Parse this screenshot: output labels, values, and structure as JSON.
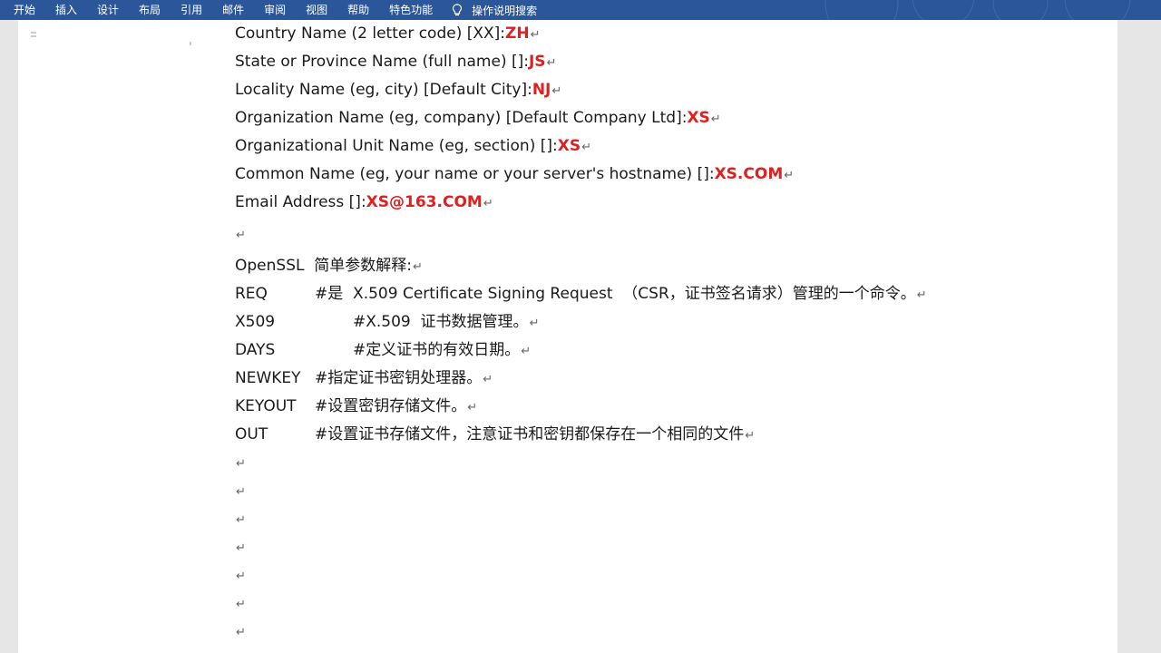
{
  "ribbon": {
    "tabs": [
      "开始",
      "插入",
      "设计",
      "布局",
      "引用",
      "邮件",
      "审阅",
      "视图",
      "帮助",
      "特色功能"
    ],
    "tell_me": "操作说明搜索",
    "tell_me_icon": "lightbulb-icon",
    "accent": "#2b579a"
  },
  "document": {
    "fields": [
      {
        "label": "Country Name (2 letter code) [XX]:",
        "value": "ZH"
      },
      {
        "label": "State or Province Name (full name) []:",
        "value": "JS"
      },
      {
        "label": "Locality Name (eg, city) [Default City]:",
        "value": "NJ"
      },
      {
        "label": "Organization Name (eg, company) [Default Company Ltd]:",
        "value": "XS"
      },
      {
        "label": "Organizational Unit Name (eg, section) []:",
        "value": "XS"
      },
      {
        "label": "Common Name (eg, your name or your server's hostname) []:",
        "value": "XS.COM"
      },
      {
        "label": "Email Address []:",
        "value": "XS@163.COM"
      }
    ],
    "value_color": "#e02020",
    "paragraph_mark": "↵",
    "section_title": "OpenSSL  简单参数解释:",
    "params": [
      {
        "name": "REQ",
        "desc": "#是  X.509 Certificate Signing Request  （CSR，证书签名请求）管理的一个命令。"
      },
      {
        "name": "X509",
        "desc": "#X.509  证书数据管理。"
      },
      {
        "name": "DAYS",
        "desc": "#定义证书的有效日期。"
      },
      {
        "name": "NEWKEY",
        "desc": "#指定证书密钥处理器。"
      },
      {
        "name": "KEYOUT",
        "desc": "#设置密钥存储文件。"
      },
      {
        "name": "OUT",
        "desc": "#设置证书存储文件，注意证书和密钥都保存在一个相同的文件"
      }
    ]
  }
}
